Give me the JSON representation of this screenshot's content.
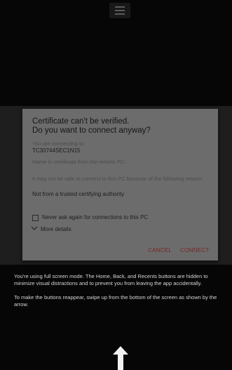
{
  "dialog": {
    "title_line1": "Certificate can't be verified.",
    "title_line2": "Do you want to connect anyway?",
    "connecting_label": "You are connecting to:",
    "connecting_value": "TC30744SEC1N15",
    "name_label": "Name in certificate from the remote PC:",
    "warning_text": "It may not be safe to connect to this PC because of the following reason:",
    "reason": "Not from a trusted certifying authority",
    "checkbox_label": "Never ask again for connections to this PC",
    "checkbox_checked": false,
    "more_details": "More details",
    "cancel_label": "CANCEL",
    "connect_label": "CONNECT"
  },
  "info": {
    "paragraph1": "You're using full screen mode. The Home, Back, and Recents buttons are hidden to minimize visual distractions and to prevent you from leaving the app accidentally.",
    "paragraph2": "To make the buttons reappear, swipe up from the bottom of the screen as shown by the arrow."
  },
  "icons": {
    "handle": "menu-handle-icon",
    "chevron": "chevron-down-icon",
    "arrow": "swipe-up-arrow-icon"
  },
  "colors": {
    "background": "#060606",
    "dialog": "#6c6c6c",
    "button_text": "#7a2424",
    "info_text": "#d6d6d6"
  }
}
